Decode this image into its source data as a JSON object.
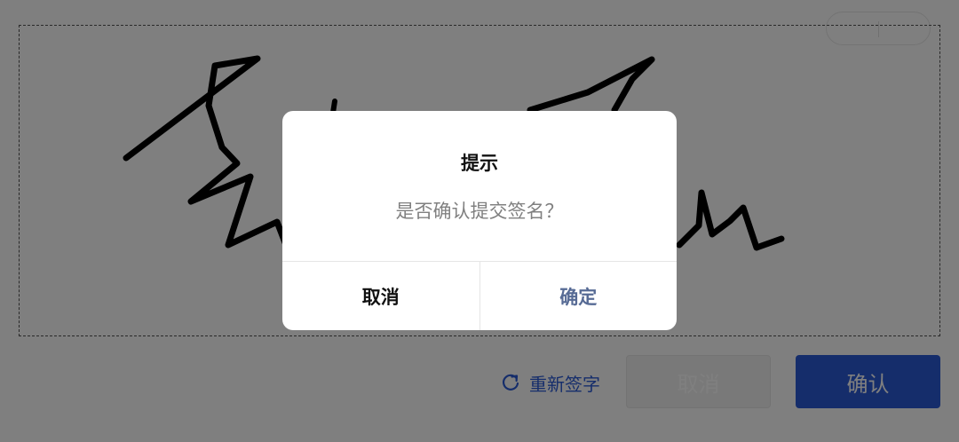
{
  "capsule": {
    "more_icon": "more-dots-icon",
    "close_icon": "target-close-icon"
  },
  "toolbar": {
    "resign_icon": "refresh-icon",
    "resign_label": "重新签字",
    "cancel_label": "取消",
    "confirm_label": "确认"
  },
  "dialog": {
    "title": "提示",
    "content": "是否确认提交签名？",
    "cancel_label": "取消",
    "confirm_label": "确定"
  },
  "colors": {
    "primary": "#2a5bd7",
    "dialog_confirm": "#576b95",
    "mask": "rgba(0,0,0,0.5)"
  }
}
